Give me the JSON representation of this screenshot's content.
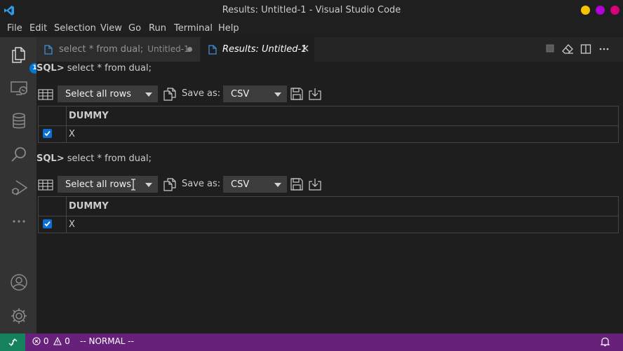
{
  "window": {
    "title": "Results: Untitled-1 - Visual Studio Code",
    "buttons": [
      {
        "name": "minimize",
        "color": "#f5c400"
      },
      {
        "name": "maximize",
        "color": "#b000d6"
      },
      {
        "name": "close",
        "color": "#d6007a"
      }
    ]
  },
  "menu": [
    "File",
    "Edit",
    "Selection",
    "View",
    "Go",
    "Run",
    "Terminal",
    "Help"
  ],
  "activity_bar": {
    "icons": [
      "explorer-icon",
      "remote-explorer-icon",
      "database-icon",
      "search-icon",
      "run-debug-icon",
      "more-icon",
      "account-icon",
      "settings-gear-icon"
    ],
    "explorer_badge": "1"
  },
  "tabs": [
    {
      "label": "select * from dual;",
      "description": "Untitled-1",
      "active": false,
      "dirty": true
    },
    {
      "label": "Results: Untitled-1",
      "active": true
    }
  ],
  "results": [
    {
      "prompt": "SQL>",
      "statement": "select * from dual;",
      "select_rows": "Select all rows",
      "save_as_label": "Save as:",
      "format": "CSV",
      "columns": [
        "DUMMY"
      ],
      "rows": [
        [
          "X"
        ]
      ]
    },
    {
      "prompt": "SQL>",
      "statement": "select * from dual;",
      "select_rows": "Select all rows",
      "save_as_label": "Save as:",
      "format": "CSV",
      "columns": [
        "DUMMY"
      ],
      "rows": [
        [
          "X"
        ]
      ]
    }
  ],
  "statusbar": {
    "errors": "0",
    "warnings": "0",
    "mode": "-- NORMAL --",
    "colors": {
      "background": "#68217a",
      "remote": "#16825d"
    }
  }
}
